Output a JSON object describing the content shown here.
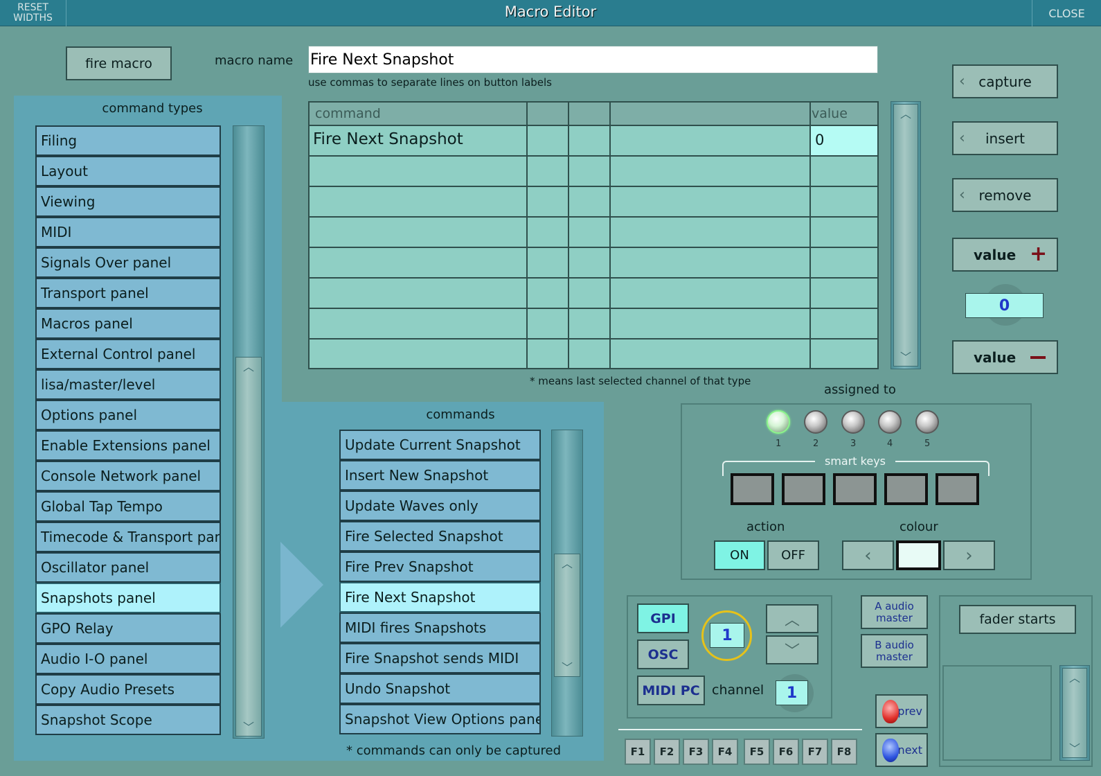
{
  "window": {
    "title": "Macro Editor",
    "reset_widths": "RESET WIDTHS",
    "close": "CLOSE"
  },
  "top": {
    "fire_macro": "fire macro",
    "macro_name_label": "macro name",
    "macro_name_value": "Fire Next Snapshot",
    "hint": "use commas to separate lines on button labels"
  },
  "table": {
    "headers": [
      "command",
      "",
      "",
      "",
      "value"
    ],
    "rows": [
      {
        "command": "Fire Next Snapshot",
        "value": "0"
      },
      {
        "command": "",
        "value": ""
      },
      {
        "command": "",
        "value": ""
      },
      {
        "command": "",
        "value": ""
      },
      {
        "command": "",
        "value": ""
      },
      {
        "command": "",
        "value": ""
      },
      {
        "command": "",
        "value": ""
      },
      {
        "command": "",
        "value": ""
      }
    ],
    "footnote": "* means last selected channel of that type"
  },
  "command_types": {
    "title": "command types",
    "selected": "Snapshots panel",
    "items": [
      "Filing",
      "Layout",
      "Viewing",
      "MIDI",
      "Signals Over panel",
      "Transport panel",
      "Macros panel",
      "External Control panel",
      "lisa/master/level",
      "Options panel",
      "Enable Extensions panel",
      "Console Network panel",
      "Global Tap Tempo",
      "Timecode & Transport panel",
      "Oscillator panel",
      "Snapshots panel",
      "GPO Relay",
      "Audio I-O panel",
      "Copy Audio Presets",
      "Snapshot Scope"
    ]
  },
  "commands": {
    "title": "commands",
    "selected": "Fire Next Snapshot",
    "items": [
      "Update Current Snapshot",
      "Insert New Snapshot",
      "Update Waves only",
      "Fire Selected Snapshot",
      "Fire Prev Snapshot",
      "Fire Next Snapshot",
      "MIDI fires Snapshots",
      "Fire Snapshot sends MIDI",
      "Undo Snapshot",
      "Snapshot View Options panel"
    ],
    "footnote": "* commands can only be captured"
  },
  "side": {
    "capture": "capture",
    "insert": "insert",
    "remove": "remove",
    "value_plus": "value",
    "value_minus": "value",
    "value_display": "0"
  },
  "assigned": {
    "title": "assigned to",
    "leds": [
      "1",
      "2",
      "3",
      "4",
      "5"
    ],
    "active_led": "1",
    "smart_keys": "smart keys",
    "action_label": "action",
    "on": "ON",
    "off": "OFF",
    "colour_label": "colour"
  },
  "gpi": {
    "gpi": "GPI",
    "osc": "OSC",
    "midi_pc": "MIDI PC",
    "number": "1",
    "channel_label": "channel",
    "channel_value": "1"
  },
  "audio": {
    "a_master": "A audio master",
    "b_master": "B audio master",
    "prev": "prev",
    "next": "next"
  },
  "fader": {
    "label": "fader starts"
  },
  "fkeys": [
    "F1",
    "F2",
    "F3",
    "F4",
    "F5",
    "F6",
    "F7",
    "F8"
  ],
  "colors": {
    "titlebar": "#2a7d8f",
    "background": "#6a9e97",
    "list_item": "#7fb9d2",
    "list_selected": "#aef2fb",
    "table_cell": "#8fcfc4",
    "on_button": "#7ff3e4"
  }
}
